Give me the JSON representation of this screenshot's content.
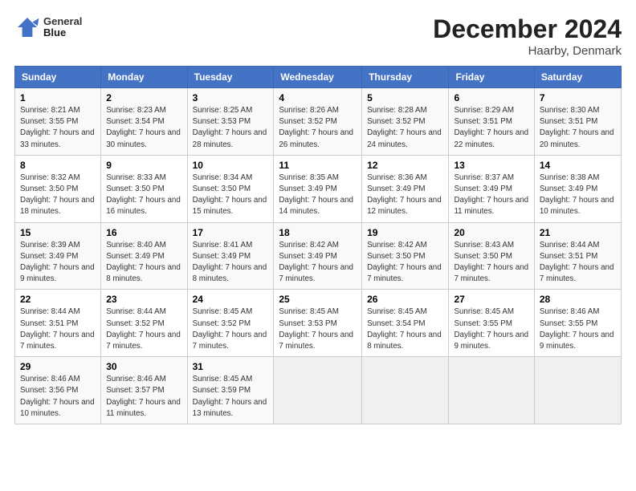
{
  "header": {
    "logo_line1": "General",
    "logo_line2": "Blue",
    "title": "December 2024",
    "subtitle": "Haarby, Denmark"
  },
  "weekdays": [
    "Sunday",
    "Monday",
    "Tuesday",
    "Wednesday",
    "Thursday",
    "Friday",
    "Saturday"
  ],
  "weeks": [
    [
      {
        "day": "1",
        "sunrise": "8:21 AM",
        "sunset": "3:55 PM",
        "daylight": "7 hours and 33 minutes."
      },
      {
        "day": "2",
        "sunrise": "8:23 AM",
        "sunset": "3:54 PM",
        "daylight": "7 hours and 30 minutes."
      },
      {
        "day": "3",
        "sunrise": "8:25 AM",
        "sunset": "3:53 PM",
        "daylight": "7 hours and 28 minutes."
      },
      {
        "day": "4",
        "sunrise": "8:26 AM",
        "sunset": "3:52 PM",
        "daylight": "7 hours and 26 minutes."
      },
      {
        "day": "5",
        "sunrise": "8:28 AM",
        "sunset": "3:52 PM",
        "daylight": "7 hours and 24 minutes."
      },
      {
        "day": "6",
        "sunrise": "8:29 AM",
        "sunset": "3:51 PM",
        "daylight": "7 hours and 22 minutes."
      },
      {
        "day": "7",
        "sunrise": "8:30 AM",
        "sunset": "3:51 PM",
        "daylight": "7 hours and 20 minutes."
      }
    ],
    [
      {
        "day": "8",
        "sunrise": "8:32 AM",
        "sunset": "3:50 PM",
        "daylight": "7 hours and 18 minutes."
      },
      {
        "day": "9",
        "sunrise": "8:33 AM",
        "sunset": "3:50 PM",
        "daylight": "7 hours and 16 minutes."
      },
      {
        "day": "10",
        "sunrise": "8:34 AM",
        "sunset": "3:50 PM",
        "daylight": "7 hours and 15 minutes."
      },
      {
        "day": "11",
        "sunrise": "8:35 AM",
        "sunset": "3:49 PM",
        "daylight": "7 hours and 14 minutes."
      },
      {
        "day": "12",
        "sunrise": "8:36 AM",
        "sunset": "3:49 PM",
        "daylight": "7 hours and 12 minutes."
      },
      {
        "day": "13",
        "sunrise": "8:37 AM",
        "sunset": "3:49 PM",
        "daylight": "7 hours and 11 minutes."
      },
      {
        "day": "14",
        "sunrise": "8:38 AM",
        "sunset": "3:49 PM",
        "daylight": "7 hours and 10 minutes."
      }
    ],
    [
      {
        "day": "15",
        "sunrise": "8:39 AM",
        "sunset": "3:49 PM",
        "daylight": "7 hours and 9 minutes."
      },
      {
        "day": "16",
        "sunrise": "8:40 AM",
        "sunset": "3:49 PM",
        "daylight": "7 hours and 8 minutes."
      },
      {
        "day": "17",
        "sunrise": "8:41 AM",
        "sunset": "3:49 PM",
        "daylight": "7 hours and 8 minutes."
      },
      {
        "day": "18",
        "sunrise": "8:42 AM",
        "sunset": "3:49 PM",
        "daylight": "7 hours and 7 minutes."
      },
      {
        "day": "19",
        "sunrise": "8:42 AM",
        "sunset": "3:50 PM",
        "daylight": "7 hours and 7 minutes."
      },
      {
        "day": "20",
        "sunrise": "8:43 AM",
        "sunset": "3:50 PM",
        "daylight": "7 hours and 7 minutes."
      },
      {
        "day": "21",
        "sunrise": "8:44 AM",
        "sunset": "3:51 PM",
        "daylight": "7 hours and 7 minutes."
      }
    ],
    [
      {
        "day": "22",
        "sunrise": "8:44 AM",
        "sunset": "3:51 PM",
        "daylight": "7 hours and 7 minutes."
      },
      {
        "day": "23",
        "sunrise": "8:44 AM",
        "sunset": "3:52 PM",
        "daylight": "7 hours and 7 minutes."
      },
      {
        "day": "24",
        "sunrise": "8:45 AM",
        "sunset": "3:52 PM",
        "daylight": "7 hours and 7 minutes."
      },
      {
        "day": "25",
        "sunrise": "8:45 AM",
        "sunset": "3:53 PM",
        "daylight": "7 hours and 7 minutes."
      },
      {
        "day": "26",
        "sunrise": "8:45 AM",
        "sunset": "3:54 PM",
        "daylight": "7 hours and 8 minutes."
      },
      {
        "day": "27",
        "sunrise": "8:45 AM",
        "sunset": "3:55 PM",
        "daylight": "7 hours and 9 minutes."
      },
      {
        "day": "28",
        "sunrise": "8:46 AM",
        "sunset": "3:55 PM",
        "daylight": "7 hours and 9 minutes."
      }
    ],
    [
      {
        "day": "29",
        "sunrise": "8:46 AM",
        "sunset": "3:56 PM",
        "daylight": "7 hours and 10 minutes."
      },
      {
        "day": "30",
        "sunrise": "8:46 AM",
        "sunset": "3:57 PM",
        "daylight": "7 hours and 11 minutes."
      },
      {
        "day": "31",
        "sunrise": "8:45 AM",
        "sunset": "3:59 PM",
        "daylight": "7 hours and 13 minutes."
      },
      null,
      null,
      null,
      null
    ]
  ]
}
